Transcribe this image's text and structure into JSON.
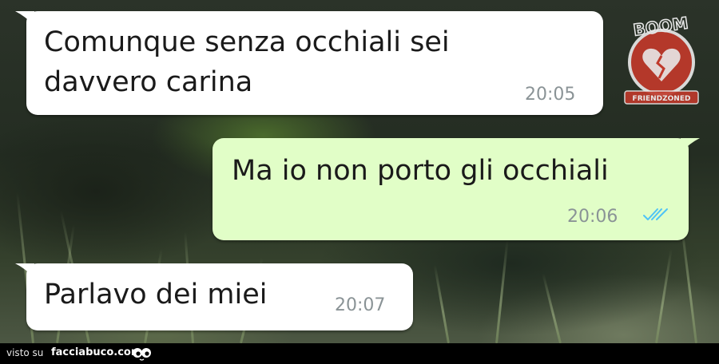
{
  "conversation": {
    "messages": [
      {
        "direction": "incoming",
        "text": "Comunque senza occhiali sei\ndavvero carina",
        "time": "20:05"
      },
      {
        "direction": "outgoing",
        "text": "Ma io non porto gli occhiali",
        "time": "20:06",
        "status": "read",
        "status_icon": "double-check-icon"
      },
      {
        "direction": "incoming",
        "text": "Parlavo dei miei",
        "time": "20:07"
      }
    ]
  },
  "watermark": {
    "logo_text": "BOOM",
    "logo_caption": "FRIENDZONED"
  },
  "footer": {
    "visto_label": "visto su",
    "site_name": "facciabuco.com",
    "mascot_icon": "eyes-icon"
  },
  "colors": {
    "incoming_bubble": "#ffffff",
    "outgoing_bubble": "#e1fec7",
    "read_ticks": "#4fc3f7",
    "timestamp": "#8a9396",
    "logo_red": "#c0392b"
  }
}
